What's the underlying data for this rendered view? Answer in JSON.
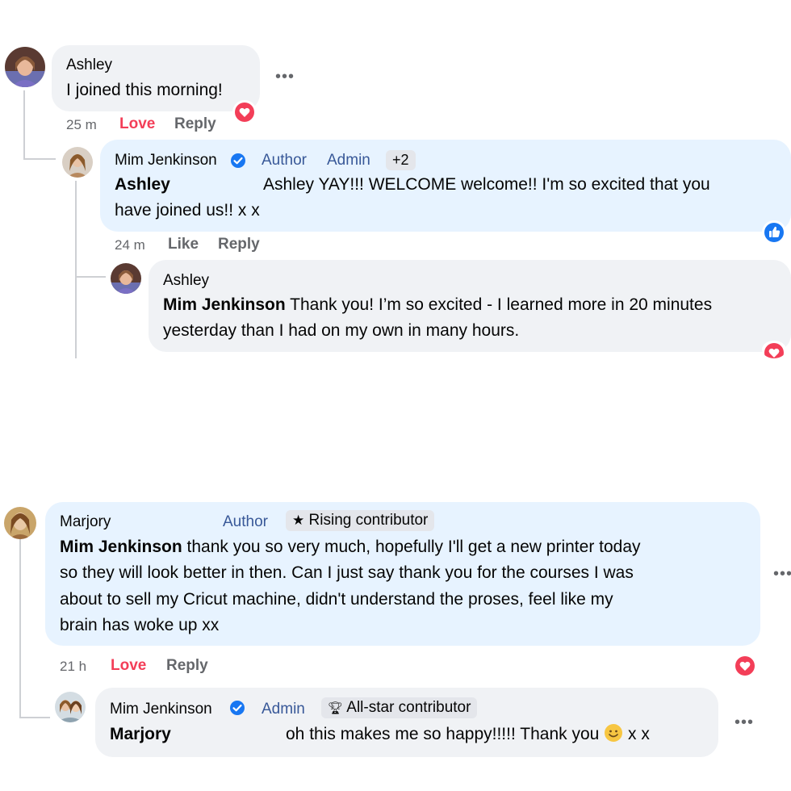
{
  "thread1": {
    "comment": {
      "author": "Ashley",
      "text": "I joined this morning!",
      "time": "25 m",
      "reaction_label": "Love",
      "reply_label": "Reply",
      "reaction_icon": "love-icon"
    },
    "reply1": {
      "author": "Mim Jenkinson",
      "badges": [
        "Author",
        "Admin"
      ],
      "extra_badges": "+2",
      "mention": "Ashley",
      "text_line1": "Ashley YAY!!! WELCOME welcome!! I'm so excited that you",
      "text_line2": "have joined us!! x x",
      "time": "24 m",
      "reaction_label": "Like",
      "reply_label": "Reply",
      "reaction_icon": "like-icon"
    },
    "reply2": {
      "author": "Ashley",
      "mention": "Mim Jenkinson",
      "text_line1": " Thank you! I’m so excited - I learned more in 20 minutes",
      "text_line2": "yesterday than I had on my own in many hours.",
      "reaction_icon": "love-icon"
    }
  },
  "thread2": {
    "comment": {
      "author": "Marjory",
      "badge": "Author",
      "contributor_badge": "Rising contributor",
      "mention": "Mim Jenkinson",
      "text_line1": " thank you so very much, hopefully I'll get a new printer today",
      "text_line2": "so they will look better in then. Can I just say thank you for the courses I was",
      "text_line3": "about to sell my Cricut machine, didn't understand the proses, feel like my",
      "text_line4": "brain has woke up xx",
      "time": "21 h",
      "reaction_label": "Love",
      "reply_label": "Reply",
      "reaction_icon": "love-icon"
    },
    "reply1": {
      "author": "Mim Jenkinson",
      "badge": "Admin",
      "contributor_badge": "All-star contributor",
      "mention": "Marjory",
      "text": "oh this makes me so happy!!!!! Thank you",
      "emoji": "🙂",
      "text_end": " x x"
    }
  },
  "colors": {
    "bubble_gray": "#f0f2f5",
    "bubble_blue": "#e7f3ff",
    "badge_blue": "#385898",
    "love_red": "#f33e58",
    "like_blue": "#1877f2",
    "verified_blue": "#1877f2"
  }
}
